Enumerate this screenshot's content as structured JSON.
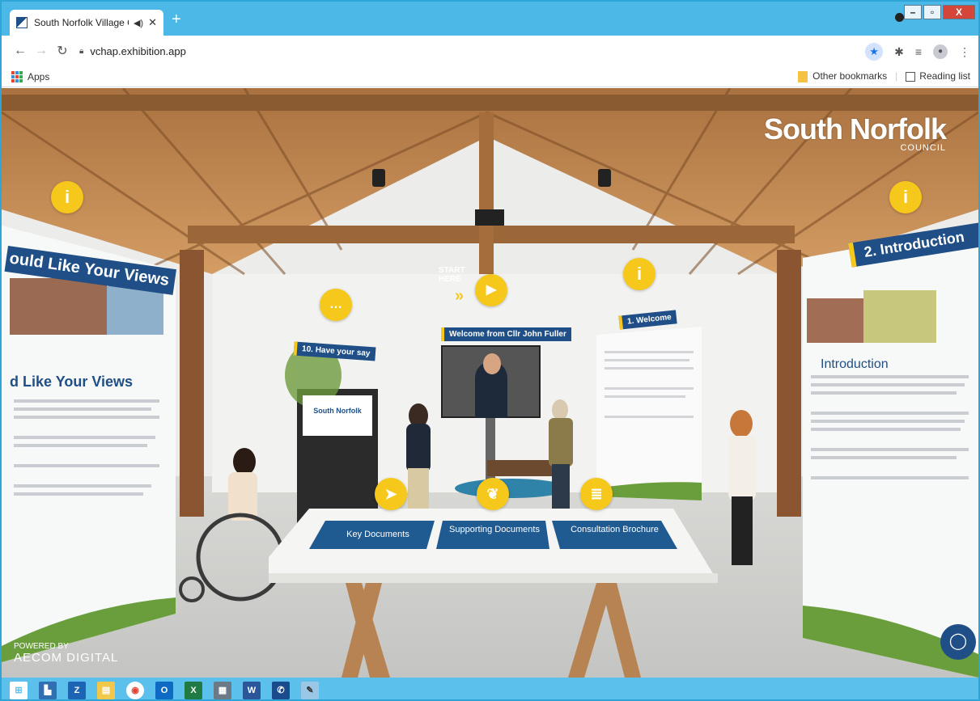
{
  "browser": {
    "tab_title": "South Norfolk Village Cluster",
    "tab_audio_icon": "speaker-icon",
    "tab_close": "✕",
    "new_tab": "+",
    "url": "vchap.exhibition.app",
    "bookmarks_apps": "Apps",
    "other_bookmarks": "Other bookmarks",
    "reading_list": "Reading list",
    "window_controls": {
      "minimize": "–",
      "maximize": "▫",
      "close": "X"
    }
  },
  "scene": {
    "logo_text": "South Norfolk",
    "logo_sub": "COUNCIL",
    "left_banner": "ould Like Your Views",
    "left_heading": "d Like Your Views",
    "right_banner": "2. Introduction",
    "right_heading": "Introduction",
    "start_label_1": "START",
    "start_label_2": "HERE",
    "chevrons": "»",
    "welcome_tag": "Welcome from Cllr John Fuller",
    "have_your_say_tag": "10. Have your say",
    "welcome_tag_2": "1. Welcome",
    "kiosk_text": "South Norfolk",
    "tiles": [
      "Key Documents",
      "Supporting Documents",
      "Consultation Brochure"
    ],
    "powered_by": "POWERED BY",
    "powered_brand": "AECOM DIGITAL",
    "info_glyph": "i"
  },
  "taskbar": {
    "icons": [
      "windows-start-icon",
      "file-explorer-icon",
      "outlook-icon",
      "folder-icon",
      "chrome-icon",
      "outlook-mail-icon",
      "excel-icon",
      "calculator-icon",
      "word-icon",
      "phone-icon",
      "paint-icon"
    ]
  },
  "colors": {
    "brand_blue": "#1f4f86",
    "accent_yellow": "#f7c81c",
    "chrome_blue": "#4cb8e7"
  }
}
